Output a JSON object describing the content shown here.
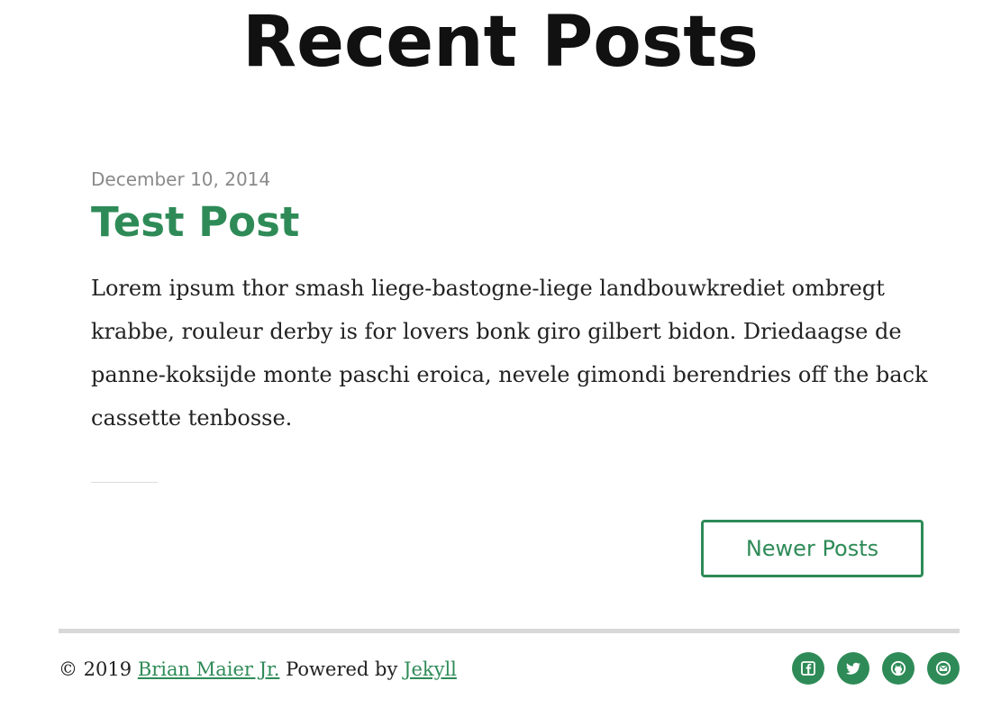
{
  "header": {
    "title": "Recent Posts"
  },
  "posts": [
    {
      "date": "December 10, 2014",
      "title": "Test Post",
      "excerpt": "Lorem ipsum thor smash liege-bastogne-liege landbouwkrediet ombregt krabbe, rouleur derby is for lovers bonk giro gilbert bidon. Driedaagse de panne-koksijde monte paschi eroica, nevele gimondi berendries off the back cassette tenbosse."
    }
  ],
  "pager": {
    "newer_label": "Newer Posts"
  },
  "footer": {
    "copyright": "© 2019",
    "author": "Brian Maier Jr.",
    "powered_by": "Powered by",
    "engine": "Jekyll",
    "social": [
      "facebook-icon",
      "twitter-icon",
      "github-icon",
      "email-icon"
    ]
  },
  "colors": {
    "accent": "#2e8b57",
    "title": "#111111",
    "date": "#8a8a8a",
    "rule": "#d8d8d8"
  }
}
